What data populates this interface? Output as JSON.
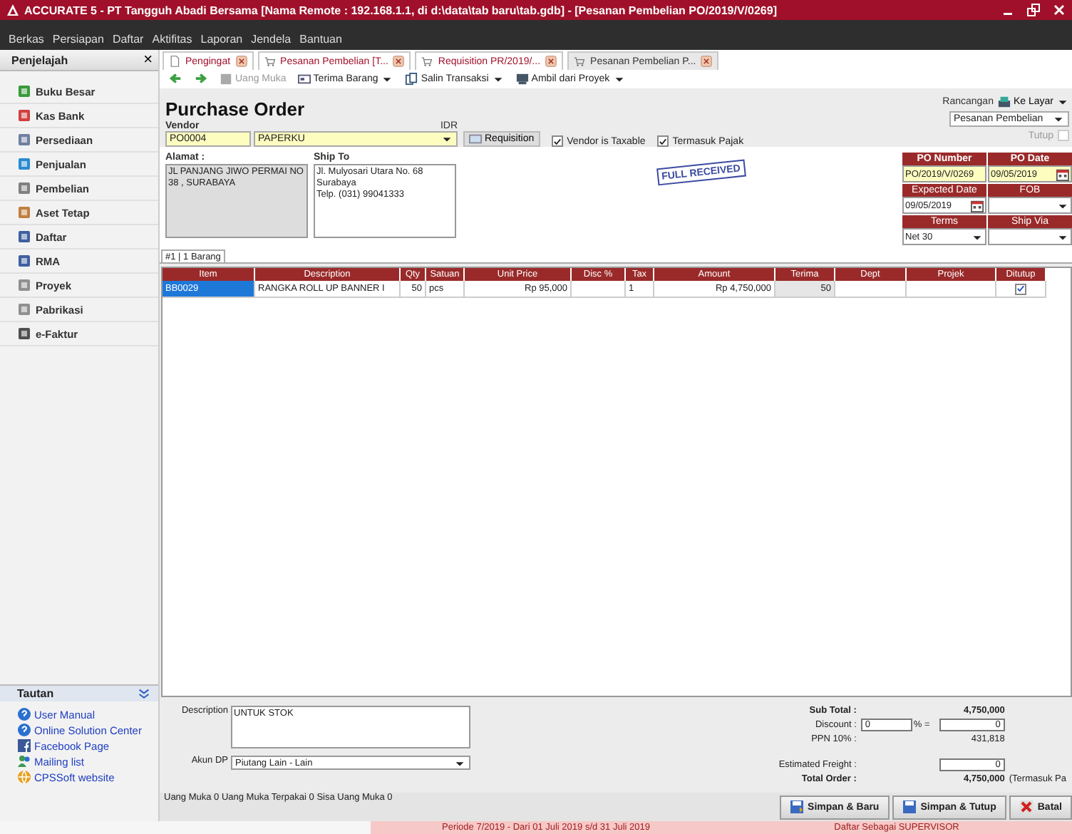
{
  "window": {
    "title": "ACCURATE 5  - PT Tangguh Abadi Bersama  [Nama Remote : 192.168.1.1, di d:\\data\\tab baru\\tab.gdb] - [Pesanan Pembelian PO/2019/V/0269]"
  },
  "menu": [
    "Berkas",
    "Persiapan",
    "Daftar",
    "Aktifitas",
    "Laporan",
    "Jendela",
    "Bantuan"
  ],
  "sidebar": {
    "title": "Penjelajah",
    "close": "×",
    "items": [
      {
        "label": "Buku Besar",
        "color": "#3a9a3a"
      },
      {
        "label": "Kas Bank",
        "color": "#d04040"
      },
      {
        "label": "Persediaan",
        "color": "#7080a0"
      },
      {
        "label": "Penjualan",
        "color": "#2a8ad0"
      },
      {
        "label": "Pembelian",
        "color": "#808080"
      },
      {
        "label": "Aset Tetap",
        "color": "#c08040"
      },
      {
        "label": "Daftar",
        "color": "#4060a0"
      },
      {
        "label": "RMA",
        "color": "#4060a0"
      },
      {
        "label": "Proyek",
        "color": "#909090"
      },
      {
        "label": "Pabrikasi",
        "color": "#909090"
      },
      {
        "label": "e-Faktur",
        "color": "#505050"
      }
    ]
  },
  "links": {
    "title": "Tautan",
    "items": [
      {
        "label": "User Manual",
        "kind": "help"
      },
      {
        "label": "Online Solution Center",
        "kind": "help"
      },
      {
        "label": "Facebook Page",
        "kind": "facebook"
      },
      {
        "label": "Mailing list",
        "kind": "people"
      },
      {
        "label": "CPSSoft website",
        "kind": "web"
      }
    ]
  },
  "tabs": [
    {
      "label": "Pengingat",
      "selected": false
    },
    {
      "label": "Pesanan Pembelian [T...",
      "selected": false
    },
    {
      "label": "Requisition PR/2019/...",
      "selected": false
    },
    {
      "label": "Pesanan Pembelian P...",
      "selected": true
    }
  ],
  "toolbar": [
    {
      "label": "Uang Muka",
      "disabled": true,
      "dropdown": false
    },
    {
      "label": "Terima Barang",
      "disabled": false,
      "dropdown": true
    },
    {
      "label": "Salin Transaksi",
      "disabled": false,
      "dropdown": true
    },
    {
      "label": "Ambil dari Proyek",
      "disabled": false,
      "dropdown": true
    }
  ],
  "form": {
    "title": "Purchase Order",
    "vendor_label": "Vendor",
    "currency": "IDR",
    "vendor_code": "PO0004",
    "vendor_name": "PAPERKU",
    "requisition": "Requisition",
    "options": [
      {
        "label": "Vendor is Taxable",
        "checked": true
      },
      {
        "label": "Termasuk Pajak",
        "checked": true
      }
    ],
    "layout_label": "Rancangan",
    "layout_button": "Ke Layar",
    "layout_select": "Pesanan Pembelian",
    "close_label": "Tutup",
    "close_checked": false,
    "address_label": "Alamat :",
    "address": "JL PANJANG JIWO PERMAI NO 38 , SURABAYA",
    "ship_to_label": "Ship To",
    "ship_to": [
      "Jl. Mulyosari Utara No. 68",
      "Surabaya",
      "Telp. (031) 99041333"
    ],
    "stamp": "FULL RECEIVED",
    "header_fields": [
      {
        "label": "PO Number",
        "value": "PO/2019/V/0269",
        "kind": "text",
        "bold": true
      },
      {
        "label": "PO Date",
        "value": "09/05/2019",
        "kind": "date",
        "bold": true
      },
      {
        "label": "Expected Date",
        "value": "09/05/2019",
        "kind": "date",
        "bold": false
      },
      {
        "label": "FOB",
        "kind": "select",
        "bold": false
      },
      {
        "label": "Terms",
        "value": "Net 30",
        "kind": "select",
        "bold": false
      },
      {
        "label": "Ship Via",
        "kind": "select",
        "bold": false
      }
    ]
  },
  "item_tab": "#1 | 1 Barang",
  "table": {
    "columns": [
      "Item",
      "Description",
      "Qty",
      "Satuan",
      "Unit Price",
      "Disc %",
      "Tax",
      "Amount",
      "Terima",
      "Dept",
      "Projek",
      "Ditutup"
    ],
    "rows": [
      {
        "cells": [
          "BB0029",
          "RANGKA ROLL UP BANNER I",
          "50",
          "pcs",
          "Rp 95,000",
          "",
          "1",
          "Rp 4,750,000",
          "50",
          "",
          ""
        ],
        "closed": true,
        "selected": true
      }
    ]
  },
  "bottom": {
    "description_label": "Description",
    "description": "UNTUK STOK",
    "akun_label": "Akun DP",
    "akun": "Piutang Lain - Lain",
    "down_payment": "Uang Muka 0  Uang Muka Terpakai 0  Sisa Uang Muka 0",
    "subtotal_label": "Sub Total :",
    "subtotal": "4,750,000",
    "discount_label": "Discount :",
    "discount_pct": "0",
    "discount_pct_sign": "% =",
    "discount": "0",
    "tax_label": "PPN 10% :",
    "tax": "431,818",
    "freight_label": "Estimated Freight :",
    "freight": "0",
    "total_label": "Total Order :",
    "total": "4,750,000",
    "total_note": "(Termasuk Pa"
  },
  "buttons": [
    {
      "label": "Simpan & Baru",
      "kind": "save-new"
    },
    {
      "label": "Simpan & Tutup",
      "kind": "save"
    },
    {
      "label": "Batal",
      "kind": "cancel"
    }
  ],
  "status_bar": {
    "period": "Periode 7/2019 - Dari 01 Juli 2019 s/d 31 Juli 2019",
    "user": "Daftar Sebagai SUPERVISOR"
  }
}
